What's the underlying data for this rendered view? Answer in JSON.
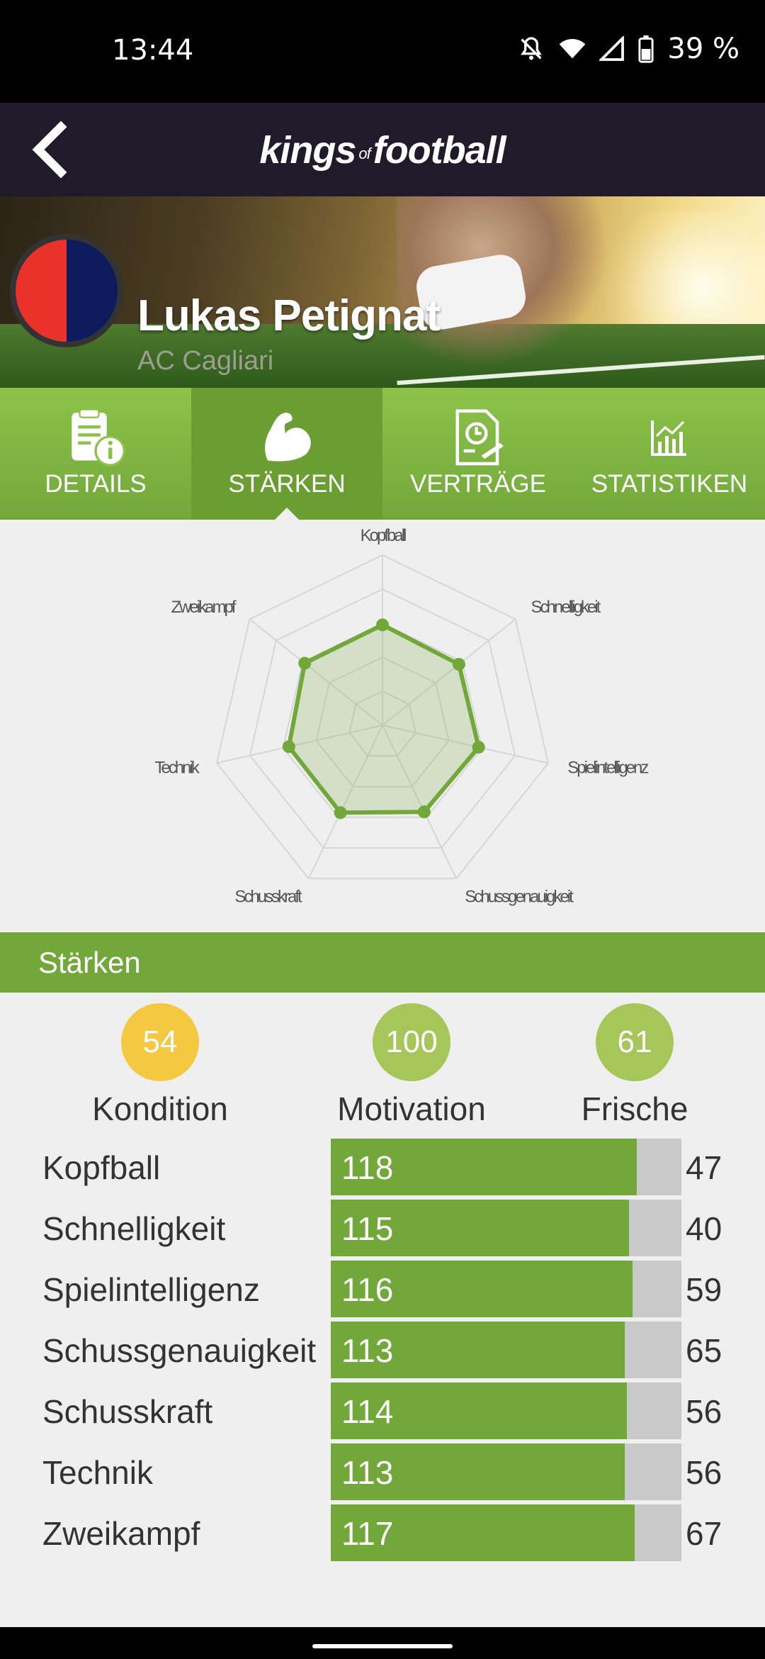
{
  "status_bar": {
    "time": "13:44",
    "battery": "39 %"
  },
  "app": {
    "logo_main_1": "kings",
    "logo_of": "of",
    "logo_main_2": "football"
  },
  "player": {
    "name": "Lukas Petignat",
    "club": "AC Cagliari",
    "club_colors": [
      "#e8322a",
      "#0d1a5c"
    ]
  },
  "tabs": [
    {
      "label": "DETAILS",
      "icon": "document-info-icon",
      "active": false
    },
    {
      "label": "STÄRKEN",
      "icon": "flexed-arm-icon",
      "active": true
    },
    {
      "label": "VERTRÄGE",
      "icon": "contract-clock-icon",
      "active": false
    },
    {
      "label": "STATISTIKEN",
      "icon": "bar-chart-icon",
      "active": false
    }
  ],
  "radar": {
    "axes": [
      "Kopfball",
      "Schnelligkeit",
      "Spielintelligenz",
      "Schussgenauigkeit",
      "Schusskraft",
      "Technik",
      "Zweikampf"
    ],
    "values": [
      118,
      115,
      116,
      113,
      114,
      113,
      117
    ],
    "max": 200
  },
  "section": {
    "title": "Stärken"
  },
  "metrics": [
    {
      "label": "Kondition",
      "value": "54",
      "color": "#f5c842"
    },
    {
      "label": "Motivation",
      "value": "100",
      "color": "#a6c65a"
    },
    {
      "label": "Frische",
      "value": "61",
      "color": "#a6c65a"
    }
  ],
  "stats": [
    {
      "name": "Kopfball",
      "value": "118",
      "right": "47",
      "fill": 0.873
    },
    {
      "name": "Schnelligkeit",
      "value": "115",
      "right": "40",
      "fill": 0.851
    },
    {
      "name": "Spielintelligenz",
      "value": "116",
      "right": "59",
      "fill": 0.861
    },
    {
      "name": "Schussgenauigkeit",
      "value": "113",
      "right": "65",
      "fill": 0.839
    },
    {
      "name": "Schusskraft",
      "value": "114",
      "right": "56",
      "fill": 0.845
    },
    {
      "name": "Technik",
      "value": "113",
      "right": "56",
      "fill": 0.839
    },
    {
      "name": "Zweikampf",
      "value": "117",
      "right": "67",
      "fill": 0.867
    }
  ]
}
